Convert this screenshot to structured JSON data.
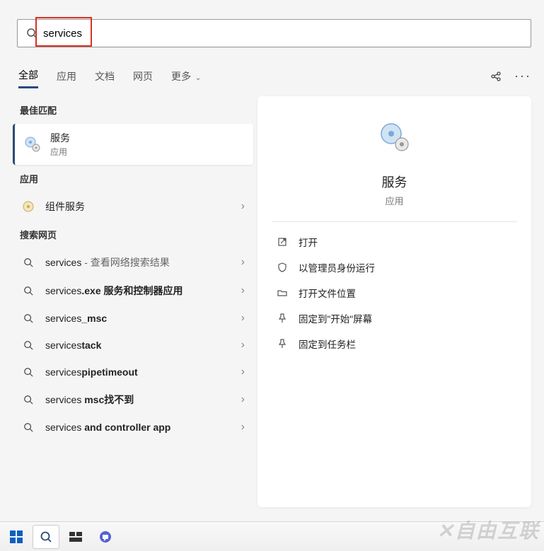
{
  "search": {
    "query": "services",
    "placeholder": ""
  },
  "tabs": {
    "items": [
      {
        "label": "全部"
      },
      {
        "label": "应用"
      },
      {
        "label": "文档"
      },
      {
        "label": "网页"
      },
      {
        "label": "更多"
      }
    ]
  },
  "sections": {
    "best_match": "最佳匹配",
    "apps": "应用",
    "web": "搜索网页"
  },
  "best_match": {
    "title": "服务",
    "subtitle": "应用"
  },
  "apps_list": [
    {
      "label": "组件服务"
    }
  ],
  "web_list": [
    {
      "prefix": "services",
      "suffix": " - 查看网络搜索结果"
    },
    {
      "prefix": "services",
      "bold": ".exe 服务和控制器应用"
    },
    {
      "prefix": "services",
      "bold": "_msc"
    },
    {
      "prefix": "services",
      "bold": "tack"
    },
    {
      "prefix": "services",
      "bold": "pipetimeout"
    },
    {
      "prefix": "services ",
      "bold": "msc找不到"
    },
    {
      "prefix": "services ",
      "bold": "and controller app"
    }
  ],
  "detail": {
    "title": "服务",
    "subtitle": "应用",
    "actions": [
      {
        "icon": "open-external-icon",
        "label": "打开"
      },
      {
        "icon": "shield-icon",
        "label": "以管理员身份运行"
      },
      {
        "icon": "folder-icon",
        "label": "打开文件位置"
      },
      {
        "icon": "pin-icon",
        "label": "固定到\"开始\"屏幕"
      },
      {
        "icon": "pin-taskbar-icon",
        "label": "固定到任务栏"
      }
    ]
  },
  "watermark": "自由互联"
}
